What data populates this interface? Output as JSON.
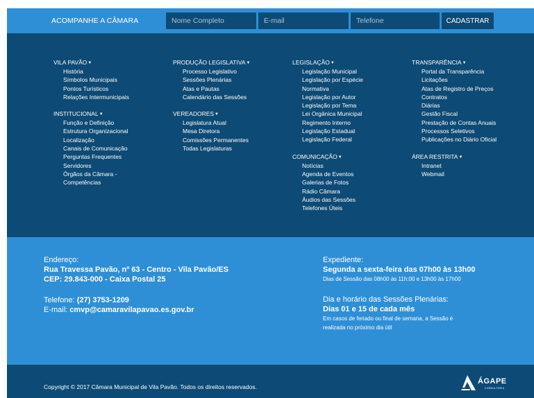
{
  "newsletter": {
    "title": "ACOMPANHE A CÂMARA",
    "name_placeholder": "Nome Completo",
    "email_placeholder": "E-mail",
    "phone_placeholder": "Telefone",
    "submit_label": "CADASTRAR"
  },
  "menu": {
    "col1": [
      {
        "title": "VILA PAVÃO",
        "items": [
          "História",
          "Símbolos Municipais",
          "Pontos Turísticos",
          "Relações Intermunicipais"
        ]
      },
      {
        "title": "INSTITUCIONAL",
        "items": [
          "Função e Definição",
          "Estrutura Organizacional",
          "Localização",
          "Canais de Comunicação",
          "Perguntas Frequentes",
          "Servidores",
          "Órgãos da Câmara -",
          "Competências"
        ]
      }
    ],
    "col2": [
      {
        "title": "PRODUÇÃO LEGISLATIVA",
        "items": [
          "Processo Legislativo",
          "Sessões Plenárias",
          "Atas e Pautas",
          "Calendário das Sessões"
        ]
      },
      {
        "title": "VEREADORES",
        "items": [
          "Legislatura Atual",
          "Mesa Diretora",
          "Comissões Permanentes",
          "Todas Legislaturas"
        ]
      }
    ],
    "col3": [
      {
        "title": "LEGISLAÇÃO",
        "items": [
          "Legislação Municipal",
          "Legislação por Espécie",
          "Normativa",
          "Legislação por Autor",
          "Legislação por Tema",
          "Lei Orgânica Municipal",
          "Regimento Interno",
          "Legislação Estadual",
          "Legislação Federal"
        ]
      },
      {
        "title": "COMUNICAÇÃO",
        "items": [
          "Notícias",
          "Agenda de Eventos",
          "Galerias de Fotos",
          "Rádio Câmara",
          "Áudios das Sessões",
          "Telefones Úteis"
        ]
      }
    ],
    "col4": [
      {
        "title": "TRANSPARÊNCIA",
        "items": [
          "Portal da Transparência",
          "Licitações",
          "Atas de Registro de Preços",
          "Contratos",
          "Diárias",
          "Gestão Fiscal",
          "Prestação de Contas Anuais",
          "Processos Seletivos",
          "Publicações no Diário Oficial"
        ]
      },
      {
        "title": "ÁREA RESTRITA",
        "items": [
          "Intranet",
          "Webmail"
        ]
      }
    ]
  },
  "info": {
    "address_label": "Endereço:",
    "address_line1": "Rua Travessa Pavão, nº 63 - Centro - Vila Pavão/ES",
    "address_line2": "CEP: 29.843-000 - Caixa Postal 25",
    "phone_label": "Telefone: ",
    "phone_value": "(27) 3753-1209",
    "email_label": "E-mail: ",
    "email_value": "cmvp@camaravilapavao.es.gov.br",
    "hours_label": "Expediente:",
    "hours_value": "Segunda a sexta-feira das 07h00 às 13h00",
    "hours_note": "Dias de Sessão das 08h00 às 11h:00 e 13h00 às 17h00",
    "sessions_label": "Dia e horário das Sessões Plenárias:",
    "sessions_value": "Dias 01 e 15 de cada mês",
    "sessions_note_1": "Em casos de feriado ou final de semana, a Sessão é",
    "sessions_note_2": "realizada no próximo dia útil"
  },
  "footer": {
    "copyright": "Copyright © 2017 Câmara Municipal de Vila Pavão. Todos os direitos reservados.",
    "logo_name": "ÁGAPE",
    "logo_sub": "CONSULTORIA"
  },
  "icons": {
    "caret": "caret-down-icon",
    "logo": "agape-logo-icon"
  },
  "colors": {
    "light_blue": "#2f8fd6",
    "dark_blue": "#0d4a75"
  }
}
